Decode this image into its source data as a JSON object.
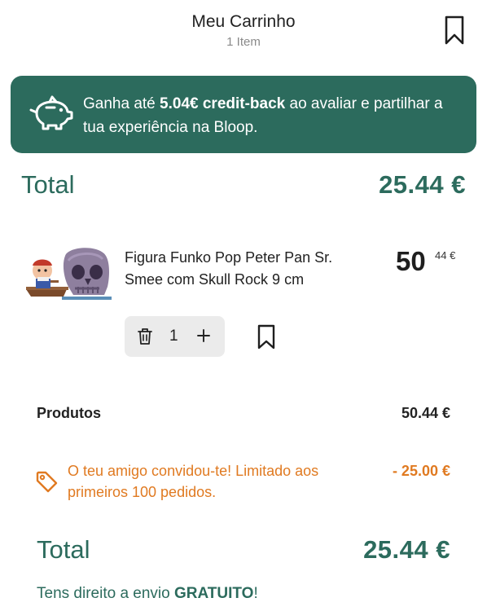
{
  "header": {
    "title": "Meu Carrinho",
    "subtitle": "1 Item",
    "bookmark_icon": "bookmark-icon"
  },
  "banner": {
    "icon": "piggy-bank-icon",
    "text_prefix": "Ganha até ",
    "text_bold": "5.04€ credit-back",
    "text_suffix": " ao avaliar e partilhar a tua experiência na Bloop.",
    "background_color": "#2c6b5d"
  },
  "summary_top": {
    "label": "Total",
    "value": "25.44 €"
  },
  "cart_item": {
    "name": "Figura Funko Pop Peter Pan Sr. Smee com Skull Rock 9 cm",
    "price_int": "50",
    "price_dec": "44 €",
    "quantity": "1",
    "trash_icon": "trash-icon",
    "plus_icon": "plus-icon",
    "bookmark_icon": "bookmark-icon"
  },
  "breakdown": {
    "products_label": "Produtos",
    "products_value": "50.44 €",
    "promo_icon": "tag-icon",
    "promo_text": "O teu amigo convidou-te! Limitado aos primeiros 100 pedidos.",
    "promo_value": "- 25.00 €",
    "promo_color": "#e07a21"
  },
  "summary_bottom": {
    "label": "Total",
    "value": "25.44 €"
  },
  "shipping": {
    "prefix": "Tens direito a envio ",
    "bold": "GRATUITO",
    "suffix": "!"
  },
  "colors": {
    "brand_green": "#2c6b5d",
    "promo_orange": "#e07a21",
    "qty_box_bg": "#ebebeb"
  }
}
